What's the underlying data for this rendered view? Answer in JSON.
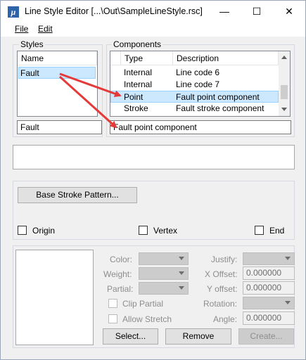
{
  "window": {
    "title": "Line Style Editor [...\\Out\\SampleLineStyle.rsc]",
    "minimize": "—",
    "maximize": "☐",
    "close": "✕"
  },
  "menu": {
    "file": "File",
    "edit": "Edit"
  },
  "styles": {
    "group_label": "Styles",
    "column": "Name",
    "items": [
      "Fault"
    ],
    "name_field": "Fault"
  },
  "components": {
    "group_label": "Components",
    "columns": [
      "Type",
      "Description"
    ],
    "rows": [
      {
        "type": "Internal",
        "description": "Line code 6"
      },
      {
        "type": "Internal",
        "description": "Line code 7"
      },
      {
        "type": "Point",
        "description": "Fault point component"
      },
      {
        "type": "Stroke",
        "description": "Fault stroke component"
      }
    ],
    "description_field": "Fault point component"
  },
  "stroke": {
    "base_button": "Base Stroke Pattern...",
    "origin": "Origin",
    "vertex": "Vertex",
    "end": "End"
  },
  "props": {
    "color": "Color:",
    "weight": "Weight:",
    "partial": "Partial:",
    "clip_partial": "Clip Partial",
    "allow_stretch": "Allow Stretch",
    "justify": "Justify:",
    "x_offset": "X Offset:",
    "x_offset_value": "0.000000",
    "y_offset": "Y offset:",
    "y_offset_value": "0.000000",
    "rotation": "Rotation:",
    "angle": "Angle:",
    "angle_value": "0.000000",
    "select_button": "Select...",
    "remove_button": "Remove",
    "create_button": "Create..."
  }
}
